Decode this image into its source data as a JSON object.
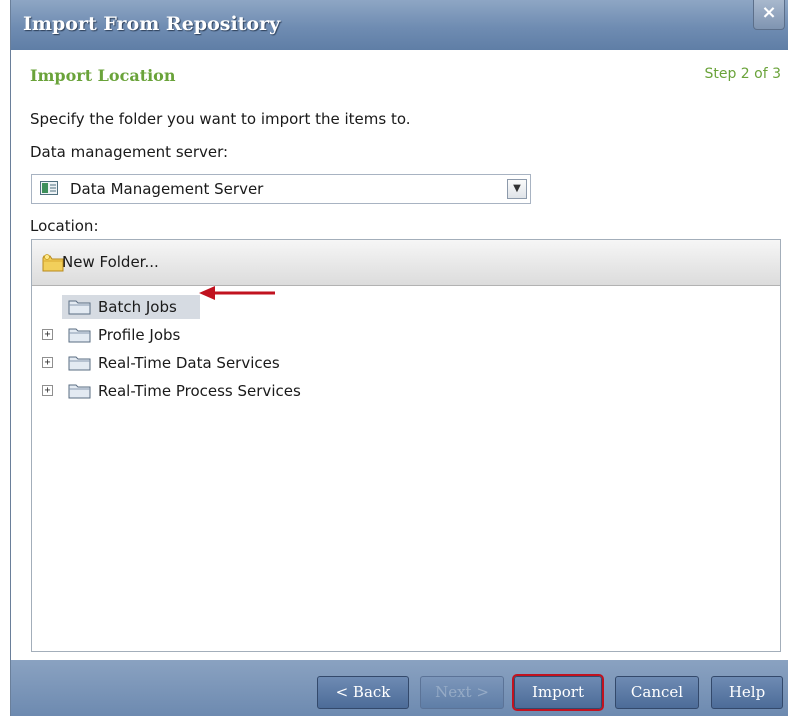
{
  "dialog": {
    "title": "Import From Repository",
    "close_label": "×"
  },
  "header": {
    "section_title": "Import Location",
    "step": "Step 2 of 3"
  },
  "instructions": "Specify the folder you want to import the items to.",
  "server": {
    "label": "Data management server:",
    "selected": "Data Management Server",
    "icon": "server-icon"
  },
  "location": {
    "label": "Location:",
    "toolbar": {
      "new_folder_label": "New Folder...",
      "icon": "new-folder-icon"
    },
    "tree": [
      {
        "label": "Batch Jobs",
        "selected": true,
        "expandable": false
      },
      {
        "label": "Profile Jobs",
        "selected": false,
        "expandable": true
      },
      {
        "label": "Real-Time Data Services",
        "selected": false,
        "expandable": true
      },
      {
        "label": "Real-Time Process Services",
        "selected": false,
        "expandable": true
      }
    ]
  },
  "footer": {
    "back_label": "< Back",
    "next_label": "Next >",
    "import_label": "Import",
    "cancel_label": "Cancel",
    "help_label": "Help"
  },
  "colors": {
    "title_bar": "#6f8cb2",
    "section_title": "#6aa33a",
    "annotation_arrow": "#c1121f",
    "selected_row": "#d6dbe2"
  }
}
